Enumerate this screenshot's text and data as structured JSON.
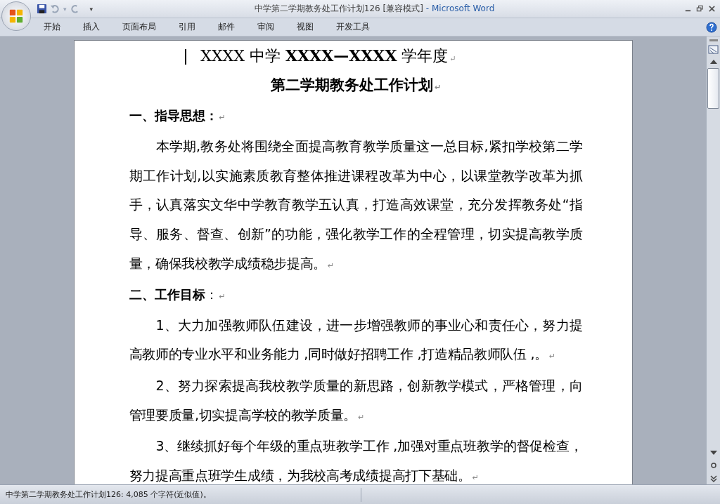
{
  "window": {
    "title": "中学第二学期教务处工作计划126 [兼容模式]",
    "app_name": "- Microsoft Word"
  },
  "quick_access": {
    "undo_caret": "▾",
    "customize": "▾"
  },
  "tabs": [
    {
      "label": "开始",
      "selected": false
    },
    {
      "label": "插入",
      "selected": false
    },
    {
      "label": "页面布局",
      "selected": false
    },
    {
      "label": "引用",
      "selected": false
    },
    {
      "label": "邮件",
      "selected": false
    },
    {
      "label": "审阅",
      "selected": false
    },
    {
      "label": "视图",
      "selected": false
    },
    {
      "label": "开发工具",
      "selected": false
    }
  ],
  "document": {
    "paragraphs": [
      {
        "kind": "title",
        "text": "XXXX 中学 **XXXX—XXXX** 学年度",
        "mark": "↵",
        "cursor": true
      },
      {
        "kind": "title_bold",
        "text": "第二学期教务处工作计划",
        "mark": "↵",
        "cursor": false
      },
      {
        "kind": "heading",
        "text": "**一、指导思想：**",
        "mark": "↵",
        "cursor": false
      },
      {
        "kind": "body",
        "text": "本学期,教务处将围绕全面提高教育教学质量这一总目标,紧扣学校第二学期工作计划,以实施素质教育整体推进课程改革为中心，以课堂教学改革为抓手，认真落实文华中学教育教学五认真，打造高效课堂，充分发挥教务处“指导、服务、督查、创新”的功能，强化教学工作的全程管理，切实提高教学质量，确保我校教学成绩稳步提高。",
        "mark": "↵",
        "cursor": false
      },
      {
        "kind": "heading",
        "text": "**二、工作目标**：",
        "mark": "↵",
        "cursor": false
      },
      {
        "kind": "body",
        "text": "1、大力加强教师队伍建设，进一步增强教师的事业心和责任心，努力提高教师的专业水平和业务能力 ,同时做好招聘工作 ,打造精品教师队伍 ,。",
        "mark": "↵",
        "cursor": false
      },
      {
        "kind": "body",
        "text": "2、努力探索提高我校教学质量的新思路，创新教学模式，严格管理，向管理要质量,切实提高学校的教学质量。",
        "mark": "↵",
        "cursor": false
      },
      {
        "kind": "body",
        "text": "3、继续抓好每个年级的重点班教学工作 ,加强对重点班教学的督促检查，努力提高重点班学生成绩，为我校高考成绩提高打下基础。",
        "mark": "↵",
        "cursor": false
      }
    ]
  },
  "status_bar": {
    "text": "中学第二学期教务处工作计划126: 4,085 个字符(近似值)。"
  }
}
